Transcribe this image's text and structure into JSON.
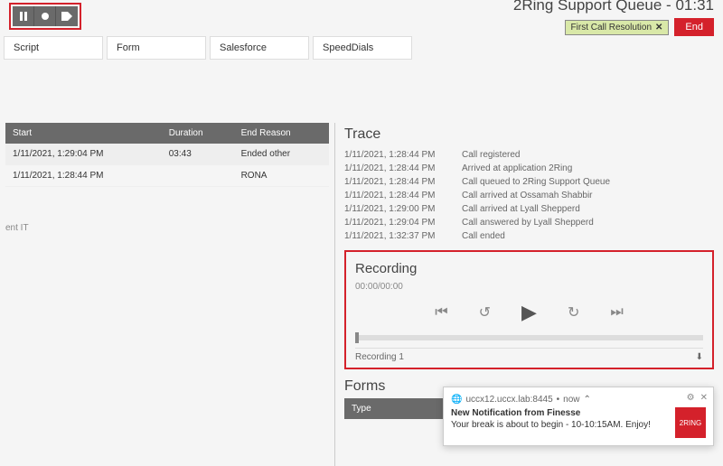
{
  "header": {
    "queue_title": "2Ring Support Queue - 01:31",
    "status_pill": "First Call Resolution",
    "end_label": "End"
  },
  "tabs": [
    "Script",
    "Form",
    "Salesforce",
    "SpeedDials"
  ],
  "history": {
    "columns": [
      "Start",
      "Duration",
      "End Reason"
    ],
    "rows": [
      {
        "start": "1/11/2021, 1:29:04 PM",
        "duration": "03:43",
        "reason": "Ended other"
      },
      {
        "start": "1/11/2021, 1:28:44 PM",
        "duration": "",
        "reason": "RONA"
      }
    ]
  },
  "tags_line": "ent   IT",
  "trace": {
    "title": "Trace",
    "rows": [
      {
        "t": "1/11/2021, 1:28:44 PM",
        "m": "Call registered"
      },
      {
        "t": "1/11/2021, 1:28:44 PM",
        "m": "Arrived at application 2Ring"
      },
      {
        "t": "1/11/2021, 1:28:44 PM",
        "m": "Call queued to 2Ring Support Queue"
      },
      {
        "t": "1/11/2021, 1:28:44 PM",
        "m": "Call arrived at Ossamah Shabbir"
      },
      {
        "t": "1/11/2021, 1:29:00 PM",
        "m": "Call arrived at Lyall Shepperd"
      },
      {
        "t": "1/11/2021, 1:29:04 PM",
        "m": "Call answered by Lyall Shepperd"
      },
      {
        "t": "1/11/2021, 1:32:37 PM",
        "m": "Call ended"
      }
    ]
  },
  "recording": {
    "title": "Recording",
    "time": "00:00/00:00",
    "label": "Recording 1"
  },
  "forms": {
    "title": "Forms",
    "col": "Type"
  },
  "notif": {
    "origin": "uccx12.uccx.lab:8445",
    "when": "now",
    "title": "New Notification from Finesse",
    "body": "Your break is about to begin - 10-10:15AM. Enjoy!",
    "badge": "2RING"
  }
}
